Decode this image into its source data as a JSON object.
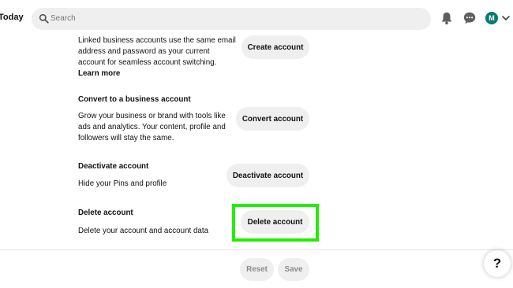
{
  "header": {
    "brand_text": "Today",
    "search_placeholder": "Search",
    "avatar_initial": "M"
  },
  "sections": {
    "linked": {
      "desc_lines": [
        "Linked business accounts use the same email",
        "address and password as your current",
        "account for seamless account switching."
      ],
      "learn_more": "Learn more",
      "button": "Create account"
    },
    "convert": {
      "title": "Convert to a business account",
      "desc_lines": [
        "Grow your business or brand with tools like",
        "ads and analytics. Your content, profile and",
        "followers will stay the same."
      ],
      "button": "Convert account"
    },
    "deactivate": {
      "title": "Deactivate account",
      "desc": "Hide your Pins and profile",
      "button": "Deactivate account"
    },
    "delete": {
      "title": "Delete account",
      "desc": "Delete your account and account data",
      "button": "Delete account"
    }
  },
  "footer": {
    "reset": "Reset",
    "save": "Save",
    "help": "?"
  },
  "colors": {
    "highlight": "#22ee00",
    "button_bg": "#efefef",
    "avatar_bg": "#0a7a6f"
  }
}
